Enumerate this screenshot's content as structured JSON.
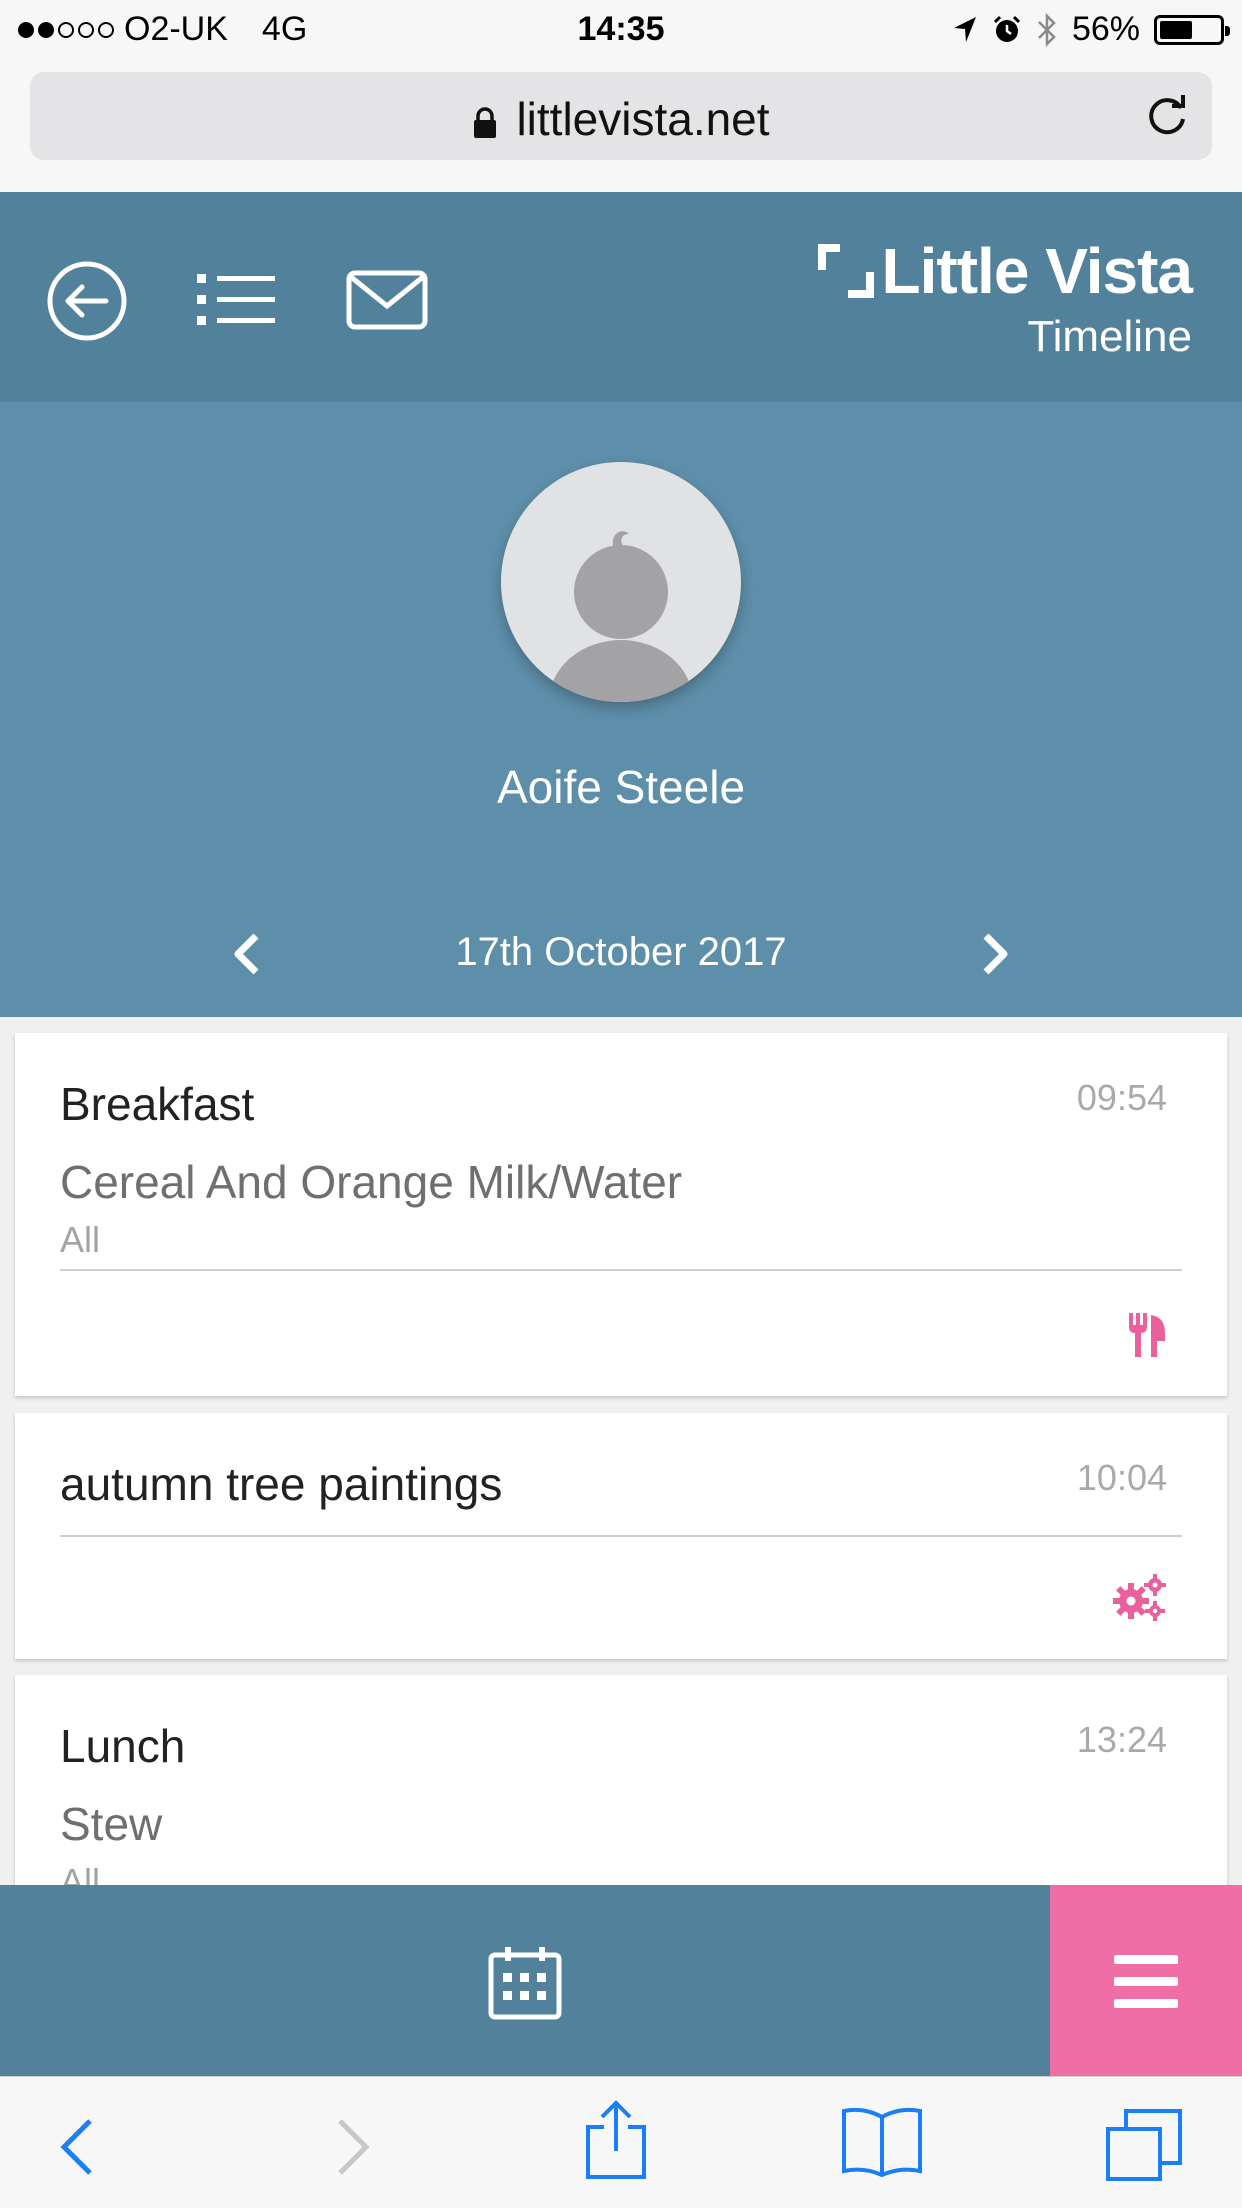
{
  "status_bar": {
    "carrier": "O2-UK",
    "network": "4G",
    "time": "14:35",
    "battery": "56%",
    "battery_level": 0.56
  },
  "browser": {
    "domain": "littlevista.net"
  },
  "header": {
    "brand": "Little Vista",
    "subtitle": "Timeline"
  },
  "profile": {
    "name": "Aoife Steele",
    "date": "17th October 2017"
  },
  "entries": [
    {
      "title": "Breakfast",
      "time": "09:54",
      "description": "Cereal And Orange Milk/Water",
      "audience": "All",
      "icon": "cutlery-icon"
    },
    {
      "title": "autumn tree paintings",
      "time": "10:04",
      "icon": "gears-icon"
    },
    {
      "title": "Lunch",
      "time": "13:24",
      "description": "Stew",
      "audience": "All"
    }
  ],
  "colors": {
    "header": "#52829b",
    "profile": "#5e8faa",
    "accent": "#ef6ea6",
    "ios_blue": "#1a7ff5"
  }
}
